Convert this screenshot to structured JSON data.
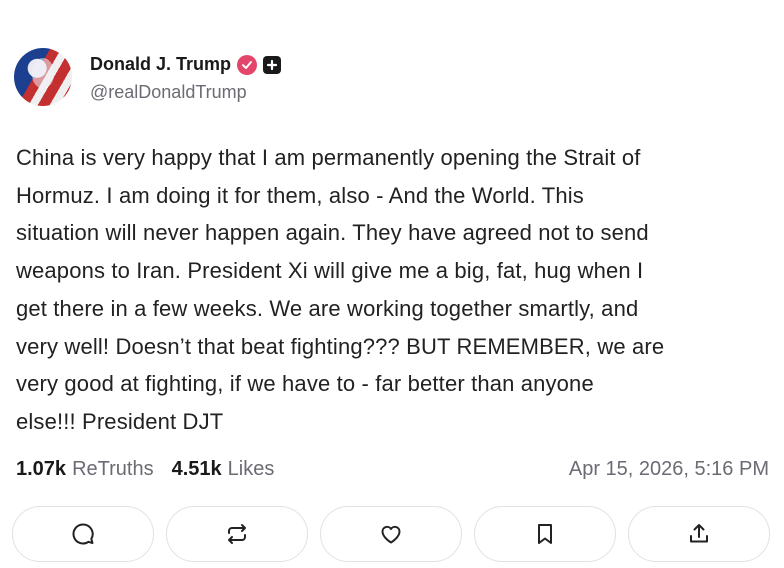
{
  "author": {
    "display_name": "Donald J. Trump",
    "handle": "@realDonaldTrump",
    "avatar_icon": "avatar-photo",
    "verified_color": "#e3466a"
  },
  "post": {
    "text": "China is very happy that I am permanently opening the Strait of\nHormuz. I am doing it for them, also - And the World. This\nsituation will never happen again. They have agreed not to send\nweapons to Iran. President Xi will give me a big, fat, hug when I\nget there in a few weeks. We are working together smartly, and\nvery well! Doesn’t that beat fighting??? BUT REMEMBER, we are\nvery good at fighting, if we have to - far better than anyone\nelse!!! President DJT"
  },
  "stats": {
    "retruths_count": "1.07k",
    "retruths_label": "ReTruths",
    "likes_count": "4.51k",
    "likes_label": "Likes",
    "timestamp": "Apr 15, 2026, 5:16 PM"
  },
  "actions": [
    {
      "icon": "reply-icon"
    },
    {
      "icon": "retruth-icon"
    },
    {
      "icon": "like-icon"
    },
    {
      "icon": "bookmark-icon"
    },
    {
      "icon": "share-icon"
    }
  ]
}
